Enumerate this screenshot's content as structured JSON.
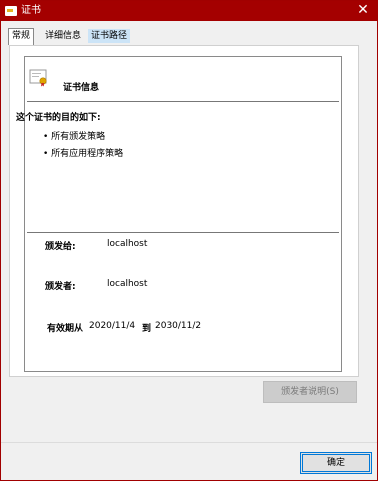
{
  "window": {
    "title": "证书",
    "close_glyph": "✕",
    "accent": "#a40000"
  },
  "tabs": [
    {
      "label": "常规"
    },
    {
      "label": "详细信息"
    },
    {
      "label": "证书路径"
    }
  ],
  "general": {
    "cert_info_title": "证书信息",
    "purpose_heading": "这个证书的目的如下:",
    "purposes": [
      "所有颁发策略",
      "所有应用程序策略"
    ],
    "issued_to_label": "颁发给:",
    "issued_to_value": "localhost",
    "issued_by_label": "颁发者:",
    "issued_by_value": "localhost",
    "validity_label": "有效期从",
    "valid_from": "2020/11/4",
    "valid_to_word": "到",
    "valid_to": "2030/11/2"
  },
  "buttons": {
    "issuer_statement": "颁发者说明(S)",
    "ok": "确定"
  }
}
